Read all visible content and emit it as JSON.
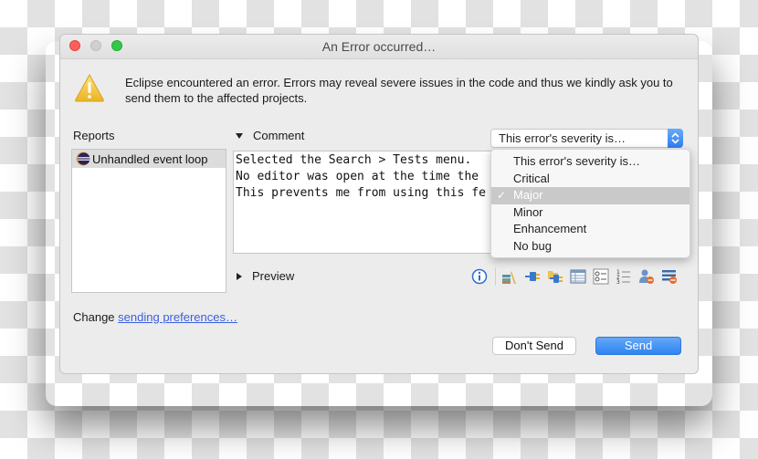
{
  "window": {
    "title": "An Error occurred…"
  },
  "message": "Eclipse encountered an error. Errors may reveal severe issues in the code and thus we kindly ask you to send them to the affected projects.",
  "reports": {
    "label": "Reports",
    "items": [
      {
        "label": "Unhandled event loop",
        "icon": "eclipse-icon",
        "selected": true
      }
    ]
  },
  "comment": {
    "label": "Comment",
    "expanded": true,
    "text": "Selected the Search > Tests menu.\nNo editor was open at the time the\nThis prevents me from using this fe"
  },
  "severity": {
    "selected": "This error's severity is…",
    "options": [
      {
        "label": "This error's severity is…",
        "checked": false
      },
      {
        "label": "Critical",
        "checked": false
      },
      {
        "label": "Major",
        "checked": true
      },
      {
        "label": "Minor",
        "checked": false
      },
      {
        "label": "Enhancement",
        "checked": false
      },
      {
        "label": "No bug",
        "checked": false
      }
    ],
    "accent_color": "#2f84f0"
  },
  "preview": {
    "label": "Preview",
    "expanded": false
  },
  "toolbar": {
    "icons": [
      "info-icon",
      "bundles-icon",
      "plugin-icon",
      "plugin-folder-icon",
      "table-icon",
      "options-list-icon",
      "numbered-list-icon",
      "user-remove-icon",
      "list-remove-icon"
    ]
  },
  "footer": {
    "change_prefix": "Change",
    "change_link": "sending preferences…"
  },
  "buttons": {
    "dont_send": "Don't Send",
    "send": "Send"
  }
}
